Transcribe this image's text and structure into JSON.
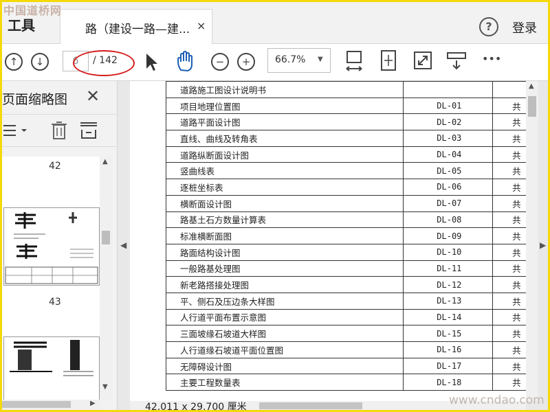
{
  "tabbar": {
    "tools_label": "工具",
    "tab_title": "路（建设一路—建...",
    "tab_close": "×",
    "help_glyph": "?",
    "login_label": "登录"
  },
  "toolbar": {
    "current_page": "6",
    "page_total": "/ 142",
    "zoom": "66.7%",
    "more_glyph": "•••"
  },
  "sidebar": {
    "title": "页面缩略图",
    "close_glyph": "✕",
    "thumbnails": [
      {
        "label": "42"
      },
      {
        "label": "43"
      }
    ]
  },
  "document": {
    "rows": [
      {
        "name": "道路施工图设计说明书",
        "code": "",
        "note": ""
      },
      {
        "name": "项目地理位置图",
        "code": "DL-01",
        "note": "共"
      },
      {
        "name": "道路平面设计图",
        "code": "DL-02",
        "note": "共"
      },
      {
        "name": "直线、曲线及转角表",
        "code": "DL-03",
        "note": "共"
      },
      {
        "name": "道路纵断面设计图",
        "code": "DL-04",
        "note": "共"
      },
      {
        "name": "竖曲线表",
        "code": "DL-05",
        "note": "共"
      },
      {
        "name": "逐桩坐标表",
        "code": "DL-06",
        "note": "共"
      },
      {
        "name": "横断面设计图",
        "code": "DL-07",
        "note": "共"
      },
      {
        "name": "路基土石方数量计算表",
        "code": "DL-08",
        "note": "共"
      },
      {
        "name": "标准横断面图",
        "code": "DL-09",
        "note": "共"
      },
      {
        "name": "路面结构设计图",
        "code": "DL-10",
        "note": "共"
      },
      {
        "name": "一般路基处理图",
        "code": "DL-11",
        "note": "共"
      },
      {
        "name": "新老路搭接处理图",
        "code": "DL-12",
        "note": "共"
      },
      {
        "name": "平、侧石及压边条大样图",
        "code": "DL-13",
        "note": "共"
      },
      {
        "name": "人行道平面布置示意图",
        "code": "DL-14",
        "note": "共"
      },
      {
        "name": "三面坡缘石坡道大样图",
        "code": "DL-15",
        "note": "共"
      },
      {
        "name": "人行道缘石坡道平面位置图",
        "code": "DL-16",
        "note": "共"
      },
      {
        "name": "无障碍设计图",
        "code": "DL-17",
        "note": "共"
      },
      {
        "name": "主要工程数量表",
        "code": "DL-18",
        "note": "共"
      }
    ],
    "page_size": "42.011 x 29.700 厘米"
  },
  "watermarks": {
    "top": "中国道桥网",
    "bottom": "www.cndao.com"
  },
  "colors": {
    "frame": "#f5d90a",
    "annotation": "#d61d1d"
  }
}
